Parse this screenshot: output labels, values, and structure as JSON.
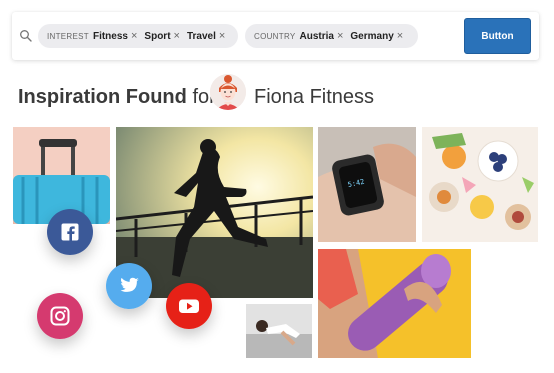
{
  "search": {
    "filters": [
      {
        "label": "INTEREST",
        "values": [
          "Fitness",
          "Sport",
          "Travel"
        ]
      },
      {
        "label": "COUNTRY",
        "values": [
          "Austria",
          "Germany"
        ]
      }
    ],
    "remove_glyph": "×",
    "button_label": "Button"
  },
  "heading": {
    "title": "Inspiration Found",
    "connector": "for",
    "persona_name": "Fiona Fitness"
  },
  "social": [
    {
      "name": "facebook",
      "color": "#3b5998"
    },
    {
      "name": "twitter",
      "color": "#55acee"
    },
    {
      "name": "instagram",
      "color": "#d53a6f"
    },
    {
      "name": "youtube",
      "color": "#e62117"
    }
  ],
  "colors": {
    "primary_button": "#2a72b9",
    "chip_background": "#ececef",
    "heading_text": "#3a3a3a"
  }
}
